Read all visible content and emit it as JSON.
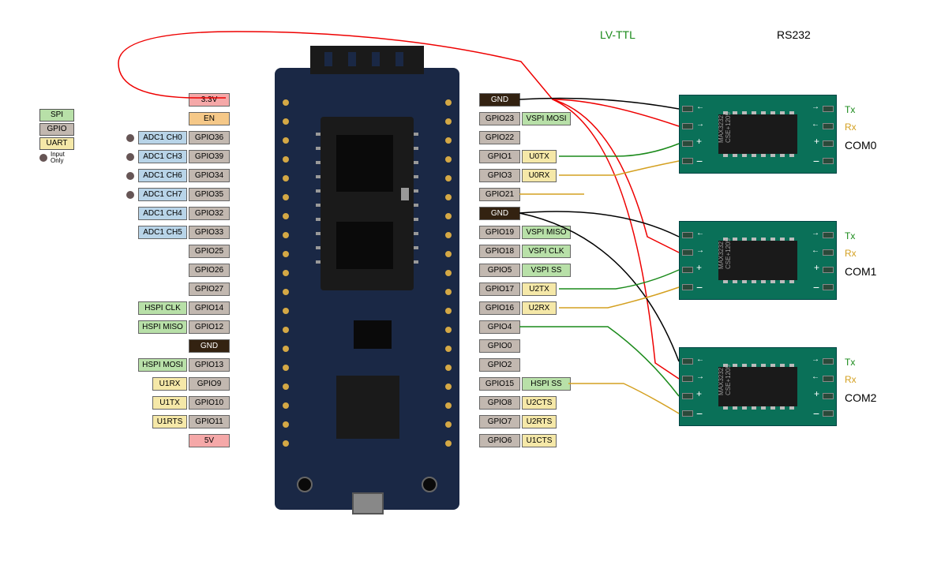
{
  "headers": {
    "lvttl": "LV-TTL",
    "rs232": "RS232"
  },
  "legend": {
    "spi": "SPI",
    "gpio": "GPIO",
    "uart": "UART",
    "input_only": "Input\nOnly"
  },
  "left_pins": [
    {
      "labels": [
        {
          "t": "3.3V",
          "c": "w-pwr"
        }
      ]
    },
    {
      "labels": [
        {
          "t": "EN",
          "c": "w-en"
        }
      ]
    },
    {
      "labels": [
        {
          "t": "ADC1 CH0",
          "c": "w-adc"
        },
        {
          "t": "GPIO36",
          "c": "w-gpio"
        }
      ],
      "dot": true
    },
    {
      "labels": [
        {
          "t": "ADC1 CH3",
          "c": "w-adc"
        },
        {
          "t": "GPIO39",
          "c": "w-gpio"
        }
      ],
      "dot": true
    },
    {
      "labels": [
        {
          "t": "ADC1 CH6",
          "c": "w-adc"
        },
        {
          "t": "GPIO34",
          "c": "w-gpio"
        }
      ],
      "dot": true
    },
    {
      "labels": [
        {
          "t": "ADC1 CH7",
          "c": "w-adc"
        },
        {
          "t": "GPIO35",
          "c": "w-gpio"
        }
      ],
      "dot": true
    },
    {
      "labels": [
        {
          "t": "ADC1 CH4",
          "c": "w-adc"
        },
        {
          "t": "GPIO32",
          "c": "w-gpio"
        }
      ]
    },
    {
      "labels": [
        {
          "t": "ADC1 CH5",
          "c": "w-adc"
        },
        {
          "t": "GPIO33",
          "c": "w-gpio"
        }
      ]
    },
    {
      "labels": [
        {
          "t": "GPIO25",
          "c": "w-gpio"
        }
      ]
    },
    {
      "labels": [
        {
          "t": "GPIO26",
          "c": "w-gpio"
        }
      ]
    },
    {
      "labels": [
        {
          "t": "GPIO27",
          "c": "w-gpio"
        }
      ]
    },
    {
      "labels": [
        {
          "t": "HSPI CLK",
          "c": "w-hspi"
        },
        {
          "t": "GPIO14",
          "c": "w-gpio"
        }
      ]
    },
    {
      "labels": [
        {
          "t": "HSPI MISO",
          "c": "w-hspi"
        },
        {
          "t": "GPIO12",
          "c": "w-gpio"
        }
      ]
    },
    {
      "labels": [
        {
          "t": "GND",
          "c": "w-gnd"
        }
      ]
    },
    {
      "labels": [
        {
          "t": "HSPI MOSI",
          "c": "w-hspi"
        },
        {
          "t": "GPIO13",
          "c": "w-gpio"
        }
      ]
    },
    {
      "labels": [
        {
          "t": "U1RX",
          "c": "w-uart"
        },
        {
          "t": "GPIO9",
          "c": "w-gpio"
        }
      ]
    },
    {
      "labels": [
        {
          "t": "U1TX",
          "c": "w-uart"
        },
        {
          "t": "GPIO10",
          "c": "w-gpio"
        }
      ]
    },
    {
      "labels": [
        {
          "t": "U1RTS",
          "c": "w-uart"
        },
        {
          "t": "GPIO11",
          "c": "w-gpio"
        }
      ]
    },
    {
      "labels": [
        {
          "t": "5V",
          "c": "w-pwr"
        }
      ]
    }
  ],
  "right_pins": [
    {
      "labels": [
        {
          "t": "GND",
          "c": "w-gnd"
        }
      ]
    },
    {
      "labels": [
        {
          "t": "GPIO23",
          "c": "w-gpio"
        },
        {
          "t": "VSPI MOSI",
          "c": "w-vspi"
        }
      ]
    },
    {
      "labels": [
        {
          "t": "GPIO22",
          "c": "w-gpio"
        }
      ]
    },
    {
      "labels": [
        {
          "t": "GPIO1",
          "c": "w-gpio"
        },
        {
          "t": "U0TX",
          "c": "w-uart"
        }
      ]
    },
    {
      "labels": [
        {
          "t": "GPIO3",
          "c": "w-gpio"
        },
        {
          "t": "U0RX",
          "c": "w-uart"
        }
      ]
    },
    {
      "labels": [
        {
          "t": "GPIO21",
          "c": "w-gpio"
        }
      ]
    },
    {
      "labels": [
        {
          "t": "GND",
          "c": "w-gnd"
        }
      ]
    },
    {
      "labels": [
        {
          "t": "GPIO19",
          "c": "w-gpio"
        },
        {
          "t": "VSPI MISO",
          "c": "w-vspi"
        }
      ]
    },
    {
      "labels": [
        {
          "t": "GPIO18",
          "c": "w-gpio"
        },
        {
          "t": "VSPI CLK",
          "c": "w-vspi"
        }
      ]
    },
    {
      "labels": [
        {
          "t": "GPIO5",
          "c": "w-gpio"
        },
        {
          "t": "VSPI SS",
          "c": "w-vspi"
        }
      ]
    },
    {
      "labels": [
        {
          "t": "GPIO17",
          "c": "w-gpio"
        },
        {
          "t": "U2TX",
          "c": "w-uart"
        }
      ]
    },
    {
      "labels": [
        {
          "t": "GPIO16",
          "c": "w-gpio"
        },
        {
          "t": "U2RX",
          "c": "w-uart"
        }
      ]
    },
    {
      "labels": [
        {
          "t": "GPIO4",
          "c": "w-gpio"
        }
      ]
    },
    {
      "labels": [
        {
          "t": "GPIO0",
          "c": "w-gpio"
        }
      ]
    },
    {
      "labels": [
        {
          "t": "GPIO2",
          "c": "w-gpio"
        }
      ]
    },
    {
      "labels": [
        {
          "t": "GPIO15",
          "c": "w-gpio"
        },
        {
          "t": "HSPI SS",
          "c": "w-hspi"
        }
      ]
    },
    {
      "labels": [
        {
          "t": "GPIO8",
          "c": "w-gpio"
        },
        {
          "t": "U2CTS",
          "c": "w-uart"
        }
      ]
    },
    {
      "labels": [
        {
          "t": "GPIO7",
          "c": "w-gpio"
        },
        {
          "t": "U2RTS",
          "c": "w-uart"
        }
      ]
    },
    {
      "labels": [
        {
          "t": "GPIO6",
          "c": "w-gpio"
        },
        {
          "t": "U1CTS",
          "c": "w-uart"
        }
      ]
    }
  ],
  "converters": [
    {
      "name": "COM0",
      "tx": "Tx",
      "rx": "Rx",
      "chip": "MAX3232\nCSE+1205"
    },
    {
      "name": "COM1",
      "tx": "Tx",
      "rx": "Rx",
      "chip": "MAX3232\nCSE+1205"
    },
    {
      "name": "COM2",
      "tx": "Tx",
      "rx": "Rx",
      "chip": "MAX3232\nCSE+1205"
    }
  ],
  "wires": {
    "colors": {
      "vcc": "#e00",
      "gnd": "#000",
      "tx": "#1a8a1a",
      "rx": "#d4a020"
    }
  }
}
